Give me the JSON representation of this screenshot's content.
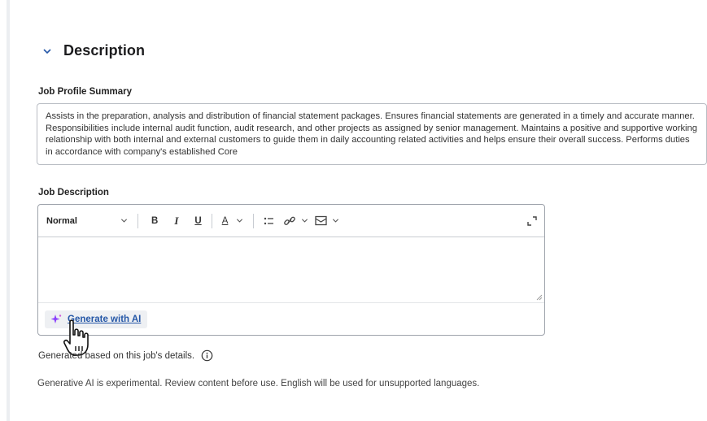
{
  "section": {
    "title": "Description"
  },
  "job_profile_summary": {
    "label": "Job Profile Summary",
    "value": "Assists in the preparation, analysis and distribution of financial statement packages. Ensures financial statements are generated in a timely and accurate manner. Responsibilities include internal audit function, audit research, and other projects as assigned by senior management. Maintains a positive and supportive working relationship with both internal and external customers to guide them in daily accounting related activities and helps ensure their overall success. Performs duties in accordance with company's established Core"
  },
  "job_description": {
    "label": "Job Description",
    "toolbar": {
      "style_select": "Normal",
      "bold": "B",
      "italic": "I",
      "underline": "U",
      "font_color": "A"
    },
    "value": "",
    "generate_button": "Generate with AI"
  },
  "generated_note": "Generated based on this job's details.",
  "disclaimer": "Generative AI is experimental. Review content before use. English will be used for unsupported languages.",
  "colors": {
    "accent": "#2557a7",
    "sparkle": "#8a3ffc",
    "border": "#9ea3ab"
  },
  "icons": [
    "chevron-down-icon",
    "bold-icon",
    "italic-icon",
    "underline-icon",
    "font-color-icon",
    "list-icon",
    "link-icon",
    "image-icon",
    "expand-icon",
    "sparkle-icon",
    "info-icon",
    "hand-cursor-icon"
  ]
}
